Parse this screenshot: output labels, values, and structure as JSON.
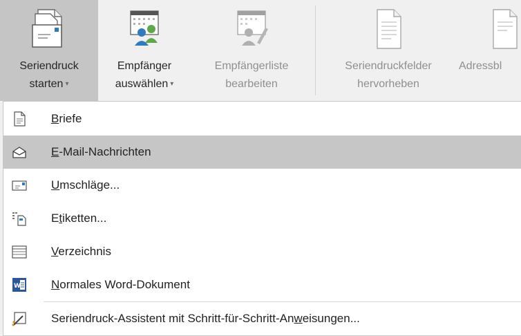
{
  "ribbon": {
    "buttons": [
      {
        "line1": "Seriendruck",
        "line2": "starten",
        "dropdown": true,
        "state": "active",
        "icon": "mail-merge-start-icon"
      },
      {
        "line1": "Empfänger",
        "line2": "auswählen",
        "dropdown": true,
        "state": "enabled",
        "icon": "select-recipients-icon"
      },
      {
        "line1": "Empfängerliste",
        "line2": "bearbeiten",
        "dropdown": false,
        "state": "disabled",
        "icon": "edit-recipient-list-icon"
      },
      {
        "line1": "Seriendruckfelder",
        "line2": "hervorheben",
        "dropdown": false,
        "state": "disabled",
        "icon": "highlight-merge-fields-icon"
      },
      {
        "line1": "Adressbl",
        "line2": "",
        "dropdown": false,
        "state": "disabled",
        "icon": "address-block-icon"
      }
    ],
    "caret": "▾"
  },
  "menu": {
    "items": [
      {
        "pre": "",
        "key": "B",
        "post": "riefe",
        "icon": "letters-icon",
        "hover": false
      },
      {
        "pre": "",
        "key": "E",
        "post": "-Mail-Nachrichten",
        "icon": "email-envelope-icon",
        "hover": true
      },
      {
        "pre": "",
        "key": "U",
        "post": "mschläge...",
        "icon": "envelopes-icon",
        "hover": false
      },
      {
        "pre": "E",
        "key": "t",
        "post": "iketten...",
        "icon": "labels-icon",
        "hover": false
      },
      {
        "pre": "",
        "key": "V",
        "post": "erzeichnis",
        "icon": "directory-icon",
        "hover": false
      },
      {
        "pre": "",
        "key": "N",
        "post": "ormales Word-Dokument",
        "icon": "word-document-icon",
        "hover": false
      },
      {
        "pre": "Seriendruck-Assistent mit Schritt-für-Schritt-An",
        "key": "w",
        "post": "eisungen...",
        "icon": "mail-merge-wizard-icon",
        "hover": false
      }
    ]
  },
  "colors": {
    "ribbon_bg": "#f0f0f0",
    "active_bg": "#c5c5c5",
    "menu_bg": "#ffffff",
    "hover_bg": "#c6c6c6",
    "word_blue": "#2b579a",
    "people_green": "#5fa84a",
    "people_blue": "#2e7bbf"
  }
}
